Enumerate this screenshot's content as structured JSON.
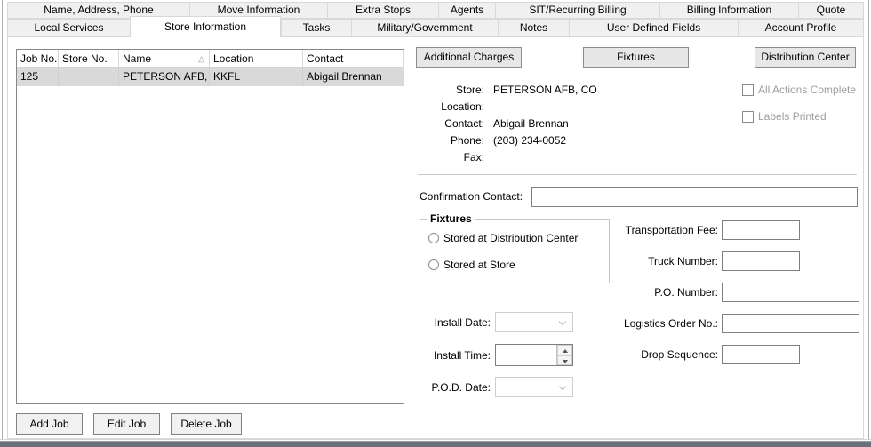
{
  "tabs_row1": [
    {
      "label": "Name, Address, Phone"
    },
    {
      "label": "Move Information"
    },
    {
      "label": "Extra Stops"
    },
    {
      "label": "Agents"
    },
    {
      "label": "SIT/Recurring Billing"
    },
    {
      "label": "Billing Information"
    },
    {
      "label": "Quote"
    }
  ],
  "tabs_row2": [
    {
      "label": "Local Services",
      "active": false
    },
    {
      "label": "Store Information",
      "active": true
    },
    {
      "label": "Tasks",
      "active": false
    },
    {
      "label": "Military/Government",
      "active": false
    },
    {
      "label": "Notes",
      "active": false
    },
    {
      "label": "User Defined Fields",
      "active": false
    },
    {
      "label": "Account Profile",
      "active": false
    }
  ],
  "job_table": {
    "columns": [
      "Job No.",
      "Store No.",
      "Name",
      "Location",
      "Contact"
    ],
    "sort_column": "Name",
    "sort_direction": "ascending",
    "sort_icon": "△",
    "rows": [
      {
        "job_no": "125",
        "store_no": "",
        "name": "PETERSON AFB, C",
        "location": "KKFL",
        "contact": "Abigail Brennan",
        "selected": true
      }
    ]
  },
  "job_buttons": {
    "add": "Add Job",
    "edit": "Edit Job",
    "delete": "Delete Job"
  },
  "action_buttons": {
    "additional_charges": "Additional Charges",
    "fixtures": "Fixtures",
    "distribution_center": "Distribution Center"
  },
  "store_info": {
    "rows": [
      {
        "label": "Store:",
        "value": "PETERSON AFB, CO"
      },
      {
        "label": "Location:",
        "value": ""
      },
      {
        "label": "Contact:",
        "value": "Abigail Brennan"
      },
      {
        "label": "Phone:",
        "value": "(203) 234-0052"
      },
      {
        "label": "Fax:",
        "value": ""
      }
    ]
  },
  "checkboxes": {
    "all_actions_complete": {
      "label": "All Actions Complete",
      "checked": false
    },
    "labels_printed": {
      "label": "Labels Printed",
      "checked": false
    }
  },
  "form": {
    "confirmation_contact": {
      "label": "Confirmation Contact:",
      "value": ""
    },
    "fixtures_group": {
      "title": "Fixtures",
      "options": [
        {
          "label": "Stored at Distribution Center",
          "selected": false
        },
        {
          "label": "Stored at Store",
          "selected": false
        }
      ]
    },
    "install_date": {
      "label": "Install Date:",
      "value": ""
    },
    "install_time": {
      "label": "Install Time:",
      "value": ""
    },
    "pod_date": {
      "label": "P.O.D. Date:",
      "value": ""
    },
    "transportation_fee": {
      "label": "Transportation Fee:",
      "value": ""
    },
    "truck_number": {
      "label": "Truck Number:",
      "value": ""
    },
    "po_number": {
      "label": "P.O. Number:",
      "value": ""
    },
    "logistics_order_no": {
      "label": "Logistics Order No.:",
      "value": ""
    },
    "drop_sequence": {
      "label": "Drop Sequence:",
      "value": ""
    }
  },
  "colors": {
    "tab_inactive_bg": "#f0f0f0",
    "tab_active_bg": "#ffffff",
    "tab_border": "#d9d9d9",
    "selected_row_bg": "#d9d9d9",
    "disabled_text": "#9e9e9e",
    "input_border": "#7f7f7f",
    "bottom_bar": "#6b717b"
  }
}
